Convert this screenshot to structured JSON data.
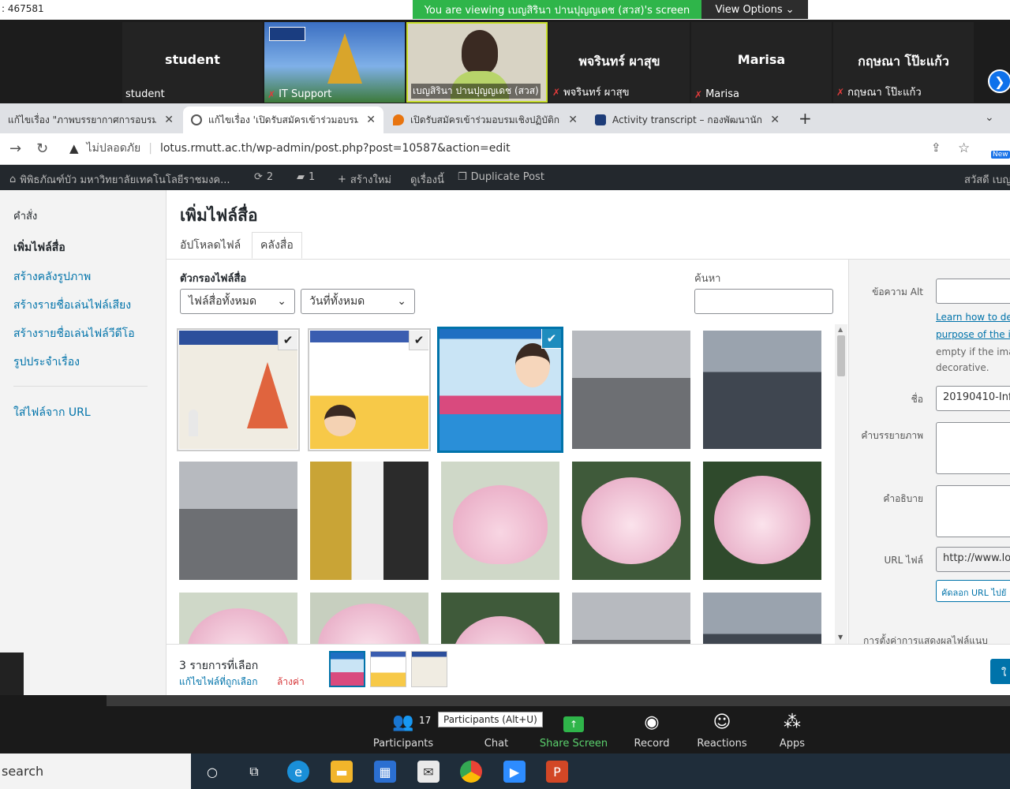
{
  "zoom": {
    "meeting_id": ": 467581",
    "viewing_banner": "You are viewing เบญสิรินา ปานปุญญเดช (สวส)'s screen",
    "view_options": "View Options",
    "participants_tiles": [
      {
        "big": "student",
        "tag": "student",
        "muted": false
      },
      {
        "big": "",
        "tag": "IT Support",
        "muted": true
      },
      {
        "big": "",
        "tag": "เบญสิรินา ปานปุญญเดช (สวส)",
        "muted": false
      },
      {
        "big": "พจรินทร์ ผาสุข",
        "tag": "พจรินทร์ ผาสุข",
        "muted": true
      },
      {
        "big": "Marisa",
        "tag": "Marisa",
        "muted": true
      },
      {
        "big": "กฤษณา โป๊ะแก้ว",
        "tag": "กฤษณา โป๊ะแก้ว",
        "muted": true
      }
    ],
    "controls": {
      "participants": "Participants",
      "participants_count": "17",
      "participants_tooltip": "Participants (Alt+U)",
      "chat": "Chat",
      "share": "Share Screen",
      "record": "Record",
      "reactions": "Reactions",
      "apps": "Apps"
    }
  },
  "browser": {
    "tabs": [
      {
        "label": "แก้ไขเรื่อง \"ภาพบรรยากาศการอบรมเ",
        "active": false
      },
      {
        "label": "แก้ไขเรื่อง 'เปิดรับสมัครเข้าร่วมอบรมเ",
        "active": true
      },
      {
        "label": "เปิดรับสมัครเข้าร่วมอบรมเชิงปฏิบัติการ",
        "active": false
      },
      {
        "label": "Activity transcript – กองพัฒนานักศึ",
        "active": false
      }
    ],
    "insecure_label": "ไม่ปลอดภัย",
    "url": "lotus.rmutt.ac.th/wp-admin/post.php?post=10587&action=edit",
    "new_badge": "New"
  },
  "wpbar": {
    "site": "พิพิธภัณฑ์บัว มหาวิทยาลัยเทคโนโลยีราชมงค...",
    "updates": "2",
    "comments": "1",
    "new": "สร้างใหม่",
    "view": "ดูเรื่องนี้",
    "duplicate": "Duplicate Post",
    "howdy": "สวัสดี เบญ"
  },
  "media": {
    "menu_heading": "คำสั่ง",
    "menu_items": [
      "เพิ่มไฟล์สื่อ",
      "สร้างคลังรูปภาพ",
      "สร้างรายชื่อเล่นไฟล์เสียง",
      "สร้างรายชื่อเล่นไฟล์วีดีโอ",
      "รูปประจำเรื่อง",
      "ใส่ไฟล์จาก URL"
    ],
    "title": "เพิ่มไฟล์สื่อ",
    "tab_upload": "อัปโหลดไฟล์",
    "tab_library": "คลังสื่อ",
    "filter_label": "ตัวกรองไฟล์สื่อ",
    "filter_type": "ไฟล์สื่อทั้งหมด",
    "filter_date": "วันที่ทั้งหมด",
    "search_label": "ค้นหา",
    "details": {
      "alt_label": "ข้อความ Alt",
      "alt_link1": "Learn how to des",
      "alt_link2": "purpose of the im",
      "alt_note1": "empty if the imag",
      "alt_note2": "decorative.",
      "title_label": "ชื่อ",
      "title_value": "20190410-Info",
      "caption_label": "คำบรรยายภาพ",
      "desc_label": "คำอธิบาย",
      "url_label": "URL ไฟล์",
      "url_value": "http://www.lot",
      "copy_url": "คัดลอก URL ไปยั",
      "display_settings": "การตั้งค่าการแสดงผลไฟล์แนบ"
    },
    "selected_count": "3 รายการที่เลือก",
    "edit_selection": "แก้ไขไฟล์ที่ถูกเลือก",
    "clear": "ล้างค่า",
    "insert": "ใ"
  },
  "taskbar": {
    "search": "search"
  },
  "colors": {
    "wp_blue": "#0073aa",
    "zoom_green": "#2fb54a",
    "zoom_blue": "#0e71eb"
  }
}
